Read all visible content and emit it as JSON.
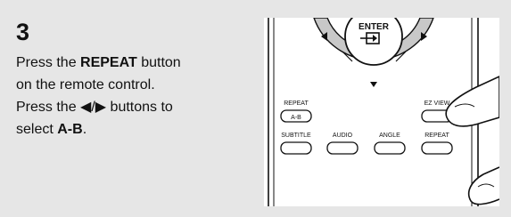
{
  "step": {
    "number": "3",
    "line1_pre": "Press the ",
    "line1_bold": "REPEAT",
    "line1_post": " button",
    "line2": "on the remote control.",
    "line3_pre": "Press the ",
    "line3_glyphs": "◀/▶",
    "line3_post": " buttons to",
    "line4_pre": "select ",
    "line4_bold": "A-B",
    "line4_post": "."
  },
  "remote": {
    "enter_label": "ENTER",
    "buttons": {
      "repeat_top": "REPEAT",
      "ab": "A-B",
      "ez_view": "EZ VIEW",
      "subtitle": "SUBTITLE",
      "audio": "AUDIO",
      "angle": "ANGLE",
      "repeat_bottom": "REPEAT"
    }
  },
  "colors": {
    "panel_bg": "#e6e6e6",
    "dpad_ring": "#c8c8c8",
    "line": "#111111"
  }
}
